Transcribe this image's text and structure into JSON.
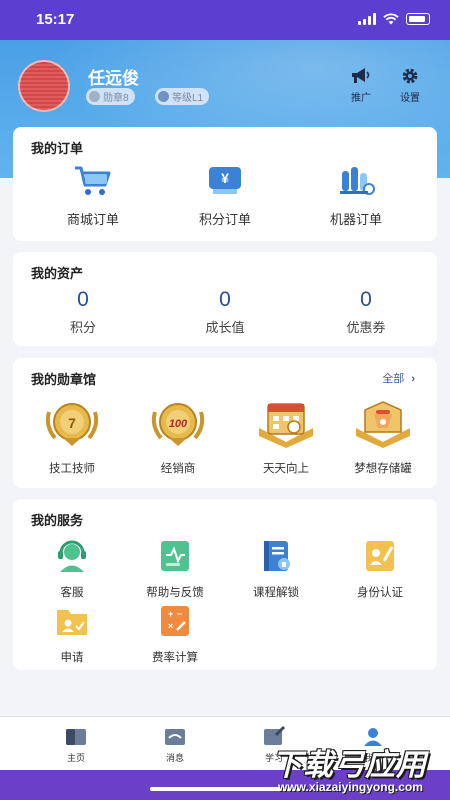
{
  "status_bar": {
    "time": "15:17"
  },
  "user": {
    "name": "任远俊",
    "medal_badge": "勋章8",
    "level_badge": "等级L1"
  },
  "header_actions": {
    "promote": "推广",
    "settings": "设置"
  },
  "orders": {
    "title": "我的订单",
    "items": [
      {
        "label": "商城订单",
        "icon": "shopping-cart-icon"
      },
      {
        "label": "积分订单",
        "icon": "points-yen-icon"
      },
      {
        "label": "机器订单",
        "icon": "machine-icon"
      }
    ]
  },
  "assets": {
    "title": "我的资产",
    "items": [
      {
        "value": "0",
        "label": "积分"
      },
      {
        "value": "0",
        "label": "成长值"
      },
      {
        "value": "0",
        "label": "优惠券"
      }
    ]
  },
  "medals": {
    "title": "我的勋章馆",
    "more": "全部",
    "items": [
      {
        "label": "技工技师",
        "icon": "gold-medal-7-icon"
      },
      {
        "label": "经销商",
        "icon": "gold-medal-100-icon"
      },
      {
        "label": "天天向上",
        "icon": "calendar-medal-icon"
      },
      {
        "label": "梦想存储罐",
        "icon": "piggy-bank-medal-icon"
      }
    ]
  },
  "services": {
    "title": "我的服务",
    "items": [
      {
        "label": "客服",
        "icon": "customer-service-icon"
      },
      {
        "label": "帮助与反馈",
        "icon": "help-feedback-icon"
      },
      {
        "label": "课程解锁",
        "icon": "course-unlock-icon"
      },
      {
        "label": "身份认证",
        "icon": "identity-verify-icon"
      },
      {
        "label": "申请",
        "icon": "application-folder-icon"
      },
      {
        "label": "费率计算",
        "icon": "rate-calculator-icon"
      }
    ]
  },
  "tabbar": [
    {
      "label": "主页",
      "icon": "home-icon"
    },
    {
      "label": "消息",
      "icon": "message-icon"
    },
    {
      "label": "学习",
      "icon": "study-icon"
    },
    {
      "label": "我的",
      "icon": "profile-icon"
    }
  ],
  "watermark": {
    "main": "下载弓应用",
    "url": "www.xiazaiyingyong.com"
  },
  "colors": {
    "header_purple": "#5b3fd1",
    "header_blue": "#4aa0e6",
    "accent_blue": "#2a4f8f",
    "page_bg": "#f3f4f7"
  }
}
